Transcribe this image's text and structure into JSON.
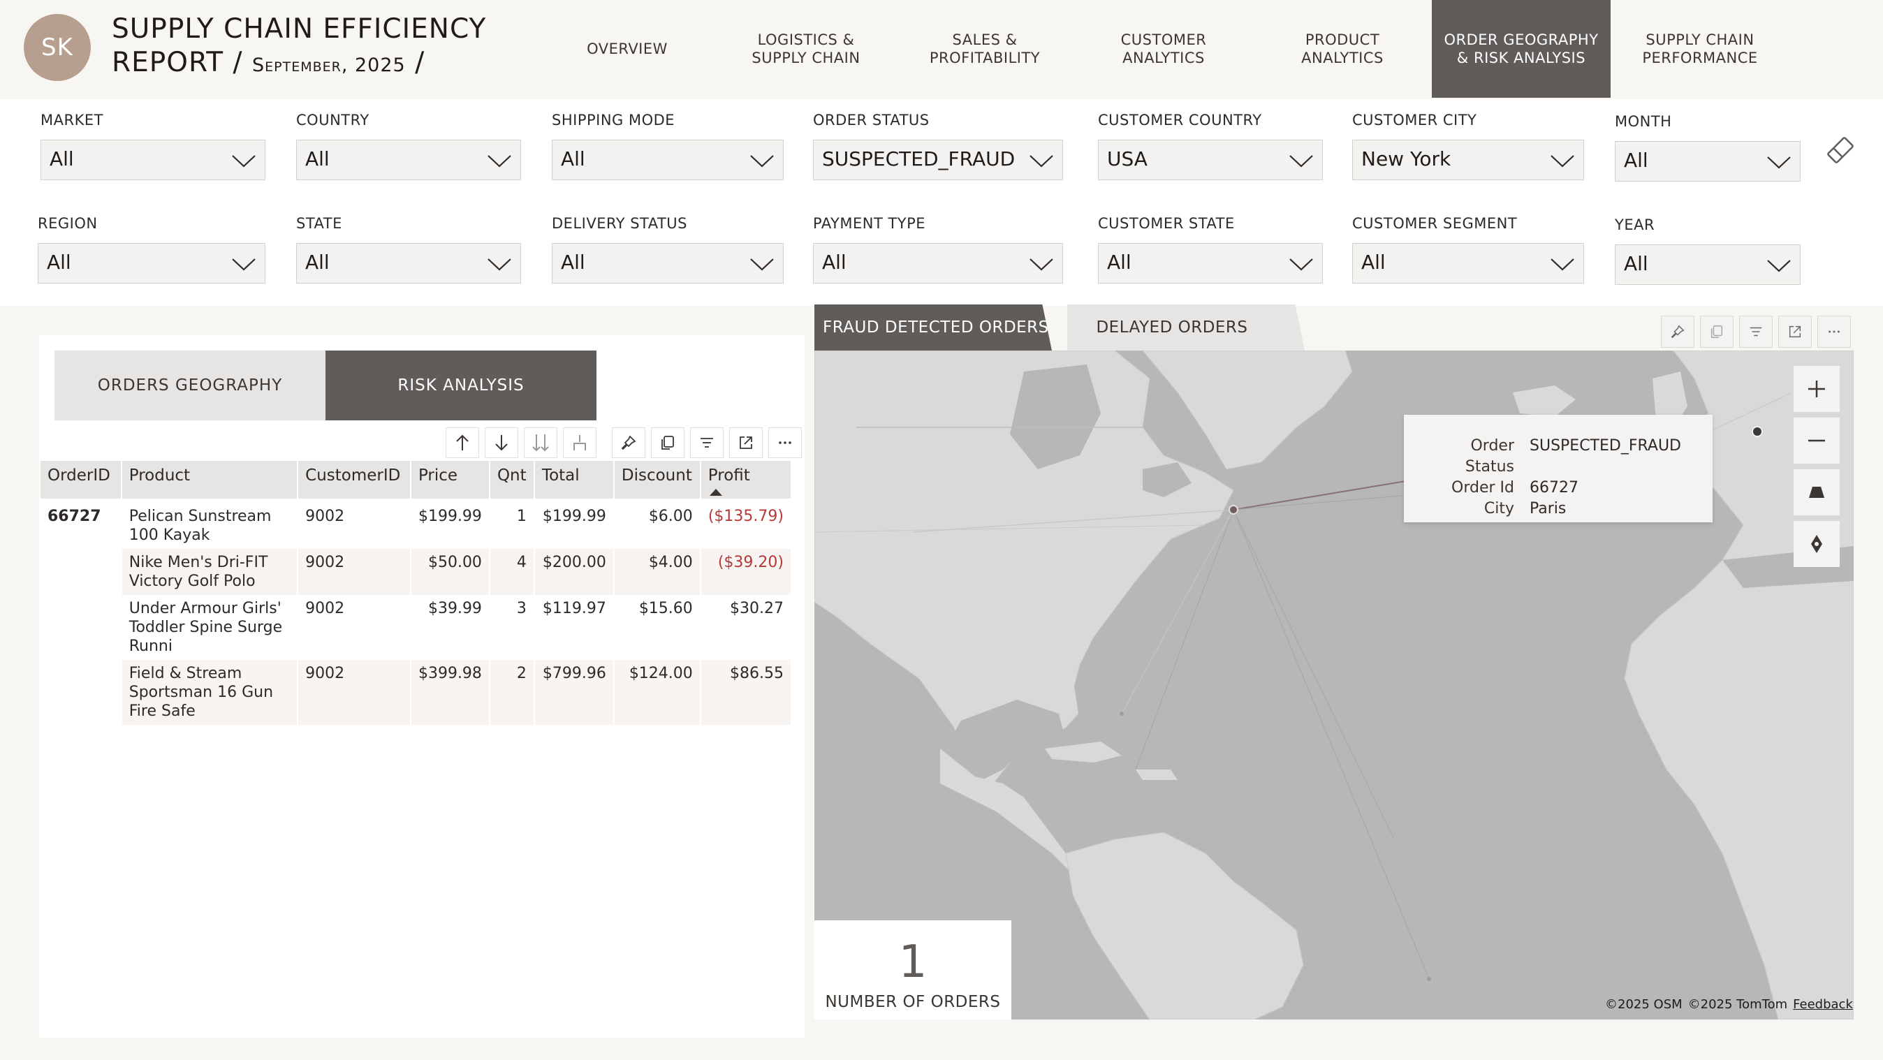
{
  "header": {
    "avatar_initials": "SK",
    "title_line1": "SUPPLY CHAIN EFFICIENCY",
    "title_line2": "REPORT / ",
    "title_date": "September, 2025",
    "title_sep": " /"
  },
  "nav": {
    "items": [
      {
        "line1": "OVERVIEW",
        "line2": ""
      },
      {
        "line1": "LOGISTICS &",
        "line2": "SUPPLY CHAIN"
      },
      {
        "line1": "SALES &",
        "line2": "PROFITABILITY"
      },
      {
        "line1": "CUSTOMER",
        "line2": "ANALYTICS"
      },
      {
        "line1": "PRODUCT",
        "line2": "ANALYTICS"
      },
      {
        "line1": "ORDER GEOGRAPHY",
        "line2": "& RISK ANALYSIS"
      },
      {
        "line1": "SUPPLY CHAIN",
        "line2": "PERFORMANCE"
      }
    ],
    "active_index": 5
  },
  "filters": {
    "market": {
      "label": "MARKET",
      "value": "All"
    },
    "country": {
      "label": "COUNTRY",
      "value": "All"
    },
    "shipping_mode": {
      "label": "SHIPPING MODE",
      "value": "All"
    },
    "order_status": {
      "label": "ORDER STATUS",
      "value": "SUSPECTED_FRAUD"
    },
    "customer_country": {
      "label": "CUSTOMER COUNTRY",
      "value": "USA"
    },
    "customer_city": {
      "label": "CUSTOMER CITY",
      "value": "New York"
    },
    "month": {
      "label": "MONTH",
      "value": "All"
    },
    "region": {
      "label": "REGION",
      "value": "All"
    },
    "state": {
      "label": "STATE",
      "value": "All"
    },
    "delivery_status": {
      "label": "DELIVERY STATUS",
      "value": "All"
    },
    "payment_type": {
      "label": "PAYMENT TYPE",
      "value": "All"
    },
    "customer_state": {
      "label": "CUSTOMER STATE",
      "value": "All"
    },
    "customer_segment": {
      "label": "CUSTOMER SEGMENT",
      "value": "All"
    },
    "year": {
      "label": "YEAR",
      "value": "All"
    }
  },
  "left_tabs": {
    "geography": "ORDERS GEOGRAPHY",
    "risk": "RISK ANALYSIS"
  },
  "table": {
    "columns": [
      "OrderID",
      "Product",
      "CustomerID",
      "Price",
      "Qnt",
      "Total",
      "Discount",
      "Profit"
    ],
    "order_id": "66727",
    "rows": [
      {
        "product_l1": "Pelican Sunstream",
        "product_l2": "100 Kayak",
        "product_l3": "",
        "customer": "9002",
        "price": "$199.99",
        "qnt": "1",
        "total": "$199.99",
        "discount": "$6.00",
        "profit": "($135.79)"
      },
      {
        "product_l1": "Nike Men's Dri-FIT",
        "product_l2": "Victory Golf Polo",
        "product_l3": "",
        "customer": "9002",
        "price": "$50.00",
        "qnt": "4",
        "total": "$200.00",
        "discount": "$4.00",
        "profit": "($39.20)"
      },
      {
        "product_l1": "Under Armour Girls'",
        "product_l2": "Toddler Spine Surge",
        "product_l3": "Runni",
        "customer": "9002",
        "price": "$39.99",
        "qnt": "3",
        "total": "$119.97",
        "discount": "$15.60",
        "profit": "$30.27"
      },
      {
        "product_l1": "Field & Stream",
        "product_l2": "Sportsman 16 Gun",
        "product_l3": "Fire Safe",
        "customer": "9002",
        "price": "$399.98",
        "qnt": "2",
        "total": "$799.96",
        "discount": "$124.00",
        "profit": "$86.55"
      }
    ]
  },
  "map_tabs": {
    "fraud": "FRAUD DETECTED ORDERS",
    "delayed": "DELAYED ORDERS"
  },
  "tooltip": {
    "k1": "Order Status",
    "v1": "SUSPECTED_FRAUD",
    "k2": "Order Id",
    "v2": "66727",
    "k3": "City",
    "v3": "Paris"
  },
  "kpi": {
    "value": "1",
    "caption": "NUMBER OF ORDERS"
  },
  "credits": {
    "osm": "©2025 OSM",
    "tomtom": "©2025 TomTom",
    "feedback": "Feedback"
  },
  "colors": {
    "accent": "#5f5c5a",
    "avatar": "#b79f8f",
    "negative": "#b43a3a",
    "map_land": "#d9d9d9",
    "map_sea": "#b7b7b7"
  }
}
